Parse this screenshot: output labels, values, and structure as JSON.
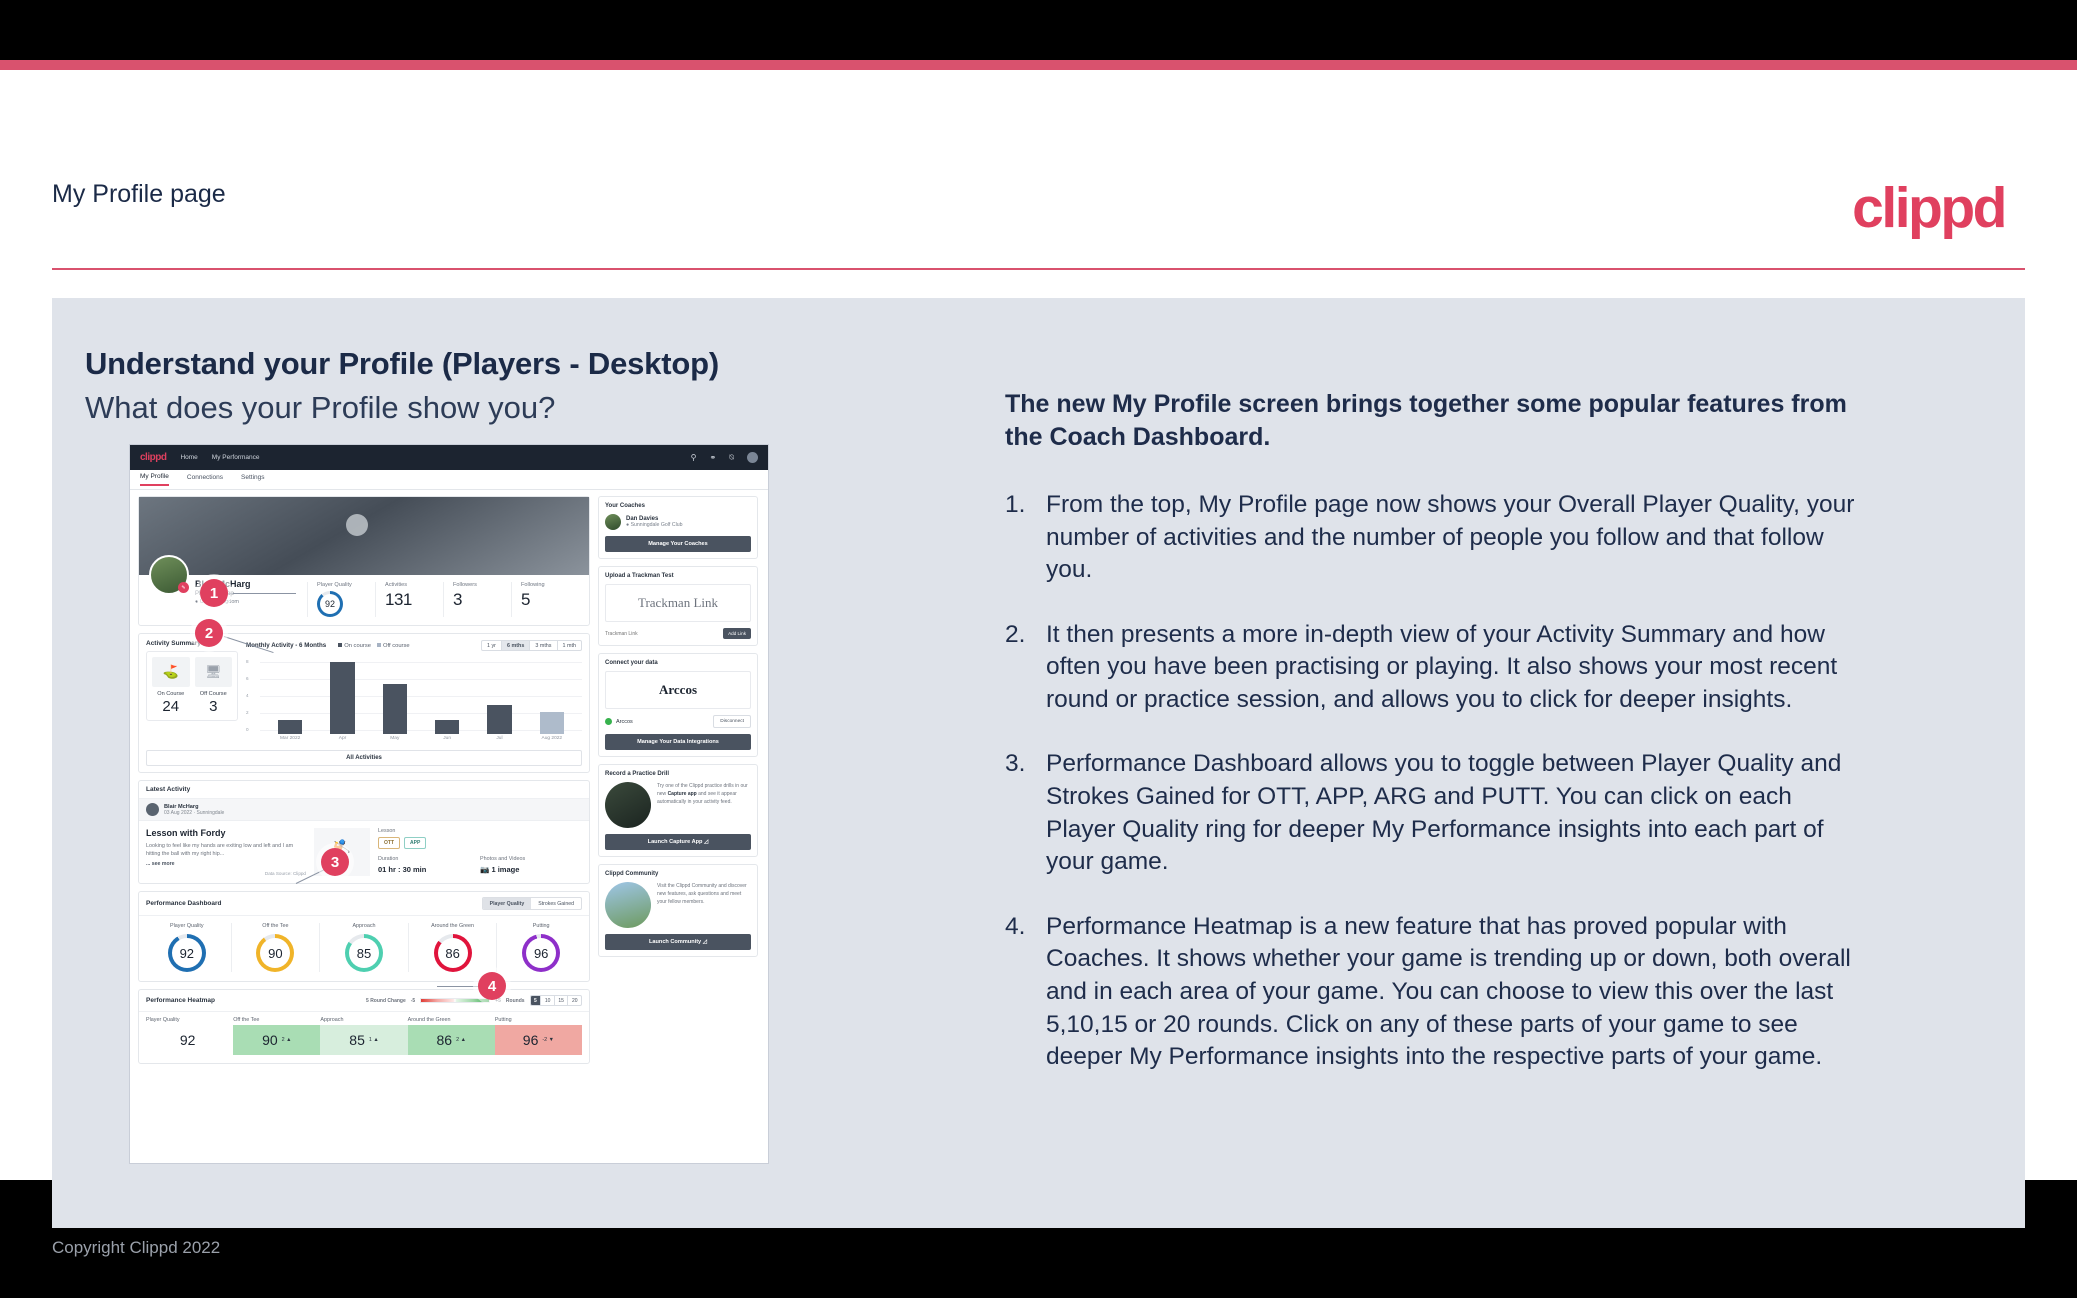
{
  "header": {
    "title": "My Profile page",
    "logo": "clippd"
  },
  "slide": {
    "heading": "Understand your Profile (Players - Desktop)",
    "subheading": "What does your Profile show you?",
    "lead": "The new My Profile screen brings together some popular features from the Coach Dashboard.",
    "points": [
      {
        "num": "1.",
        "text": "From the top, My Profile page now shows your Overall Player Quality, your number of activities and the number of people you follow and that follow you."
      },
      {
        "num": "2.",
        "text": "It then presents a more in-depth view of your Activity Summary and how often you have been practising or playing. It also shows your most recent round or practice session, and allows you to click for deeper insights."
      },
      {
        "num": "3.",
        "text": "Performance Dashboard allows you to toggle between Player Quality and Strokes Gained for OTT, APP, ARG and PUTT. You can click on each Player Quality ring for deeper My Performance insights into each part of your game."
      },
      {
        "num": "4.",
        "text": "Performance Heatmap is a new feature that has proved popular with Coaches. It shows whether your game is trending up or down, both overall and in each area of your game. You can choose to view this over the last 5,10,15 or 20 rounds. Click on any of these parts of your game to see deeper My Performance insights into the respective parts of your game."
      }
    ],
    "callouts": [
      "1",
      "2",
      "3",
      "4"
    ]
  },
  "app": {
    "nav": {
      "logo": "clippd",
      "links": [
        "Home",
        "My Performance"
      ],
      "icons": [
        "search-icon",
        "community-icon",
        "add-circle-icon",
        "avatar-icon"
      ]
    },
    "tabs": [
      {
        "label": "My Profile",
        "active": true
      },
      {
        "label": "Connections",
        "active": false
      },
      {
        "label": "Settings",
        "active": false
      }
    ],
    "profile": {
      "name": "Blair McHarg",
      "handicap": "Plus Handicap",
      "location": "United Kingdom",
      "stats": [
        {
          "label": "Player Quality",
          "value": "92",
          "type": "ring"
        },
        {
          "label": "Activities",
          "value": "131",
          "type": "number"
        },
        {
          "label": "Followers",
          "value": "3",
          "type": "number"
        },
        {
          "label": "Following",
          "value": "5",
          "type": "number"
        }
      ]
    },
    "activity_summary": {
      "title": "Activity Summary",
      "chart_title": "Monthly Activity - 6 Months",
      "legend": [
        "On course",
        "Off course"
      ],
      "ranges": [
        {
          "label": "1 yr",
          "active": false
        },
        {
          "label": "6 mths",
          "active": true
        },
        {
          "label": "3 mths",
          "active": false
        },
        {
          "label": "1 mth",
          "active": false
        }
      ],
      "counters": [
        {
          "label": "On Course",
          "value": "24",
          "icon": "golf-flag-icon"
        },
        {
          "label": "Off Course",
          "value": "3",
          "icon": "monitor-icon"
        }
      ],
      "all_activities": "All Activities"
    },
    "latest_activity": {
      "title": "Latest Activity",
      "user": "Blair McHarg",
      "meta": "03 Aug 2022 · Sunningdale",
      "post_title": "Lesson with Fordy",
      "post_desc": "Looking to feel like my hands are exiting low and left and I am hitting the ball with my right hip...",
      "see_more": "... see more",
      "data_source": "Data Source: Clippd",
      "type_label": "Lesson",
      "chips": [
        "OTT",
        "APP"
      ],
      "duration_label": "Duration",
      "duration_value": "01 hr : 30 min",
      "media_label": "Photos and Videos",
      "media_value": "1 image"
    },
    "performance_dashboard": {
      "title": "Performance Dashboard",
      "toggle": [
        {
          "label": "Player Quality",
          "active": true
        },
        {
          "label": "Strokes Gained",
          "active": false
        }
      ],
      "rings": [
        {
          "label": "Player Quality",
          "value": "92",
          "color": "#1f6fb2"
        },
        {
          "label": "Off the Tee",
          "value": "90",
          "color": "#f0b429"
        },
        {
          "label": "Approach",
          "value": "85",
          "color": "#4ecfb0"
        },
        {
          "label": "Around the Green",
          "value": "86",
          "color": "#e0143c"
        },
        {
          "label": "Putting",
          "value": "96",
          "color": "#8e2fc9"
        }
      ]
    },
    "performance_heatmap": {
      "title": "Performance Heatmap",
      "change_label": "5 Round Change",
      "scale_min": "-5",
      "scale_max": "+5",
      "rounds_label": "Rounds",
      "rounds": [
        {
          "label": "5",
          "active": true
        },
        {
          "label": "10",
          "active": false
        },
        {
          "label": "15",
          "active": false
        },
        {
          "label": "20",
          "active": false
        }
      ],
      "cells": [
        {
          "label": "Player Quality",
          "value": "92",
          "delta": "",
          "bg": "#ffffff"
        },
        {
          "label": "Off the Tee",
          "value": "90",
          "delta": "2 ▲",
          "bg": "#a9ddb4"
        },
        {
          "label": "Approach",
          "value": "85",
          "delta": "1 ▲",
          "bg": "#d7eedd"
        },
        {
          "label": "Around the Green",
          "value": "86",
          "delta": "2 ▲",
          "bg": "#a9ddb4"
        },
        {
          "label": "Putting",
          "value": "96",
          "delta": "-2 ▼",
          "bg": "#f0a8a2"
        }
      ]
    },
    "sidebar": {
      "coaches": {
        "title": "Your Coaches",
        "coach_name": "Dan Davies",
        "coach_club": "Sunningdale Golf Club",
        "button": "Manage Your Coaches"
      },
      "trackman": {
        "title": "Upload a Trackman Test",
        "logo": "Trackman Link",
        "input_placeholder": "Trackman Link",
        "button": "Add Link"
      },
      "connect": {
        "title": "Connect your data",
        "logo": "Arccos",
        "source": "Arccos",
        "disconnect": "Disconnect",
        "button": "Manage Your Data Integrations"
      },
      "drill": {
        "title": "Record a Practice Drill",
        "text_1": "Try one of the Clippd practice drills in our new ",
        "text_bold": "Capture app",
        "text_2": " and see it appear automatically in your activity feed.",
        "button": "Launch Capture App"
      },
      "community": {
        "title": "Clippd Community",
        "text": "Visit the Clippd Community and discover new features, ask questions and meet your fellow members.",
        "button": "Launch Community"
      }
    }
  },
  "footer": {
    "copyright": "Copyright Clippd 2022"
  },
  "chart_data": {
    "type": "bar",
    "title": "Monthly Activity - 6 Months",
    "categories": [
      "Mar 2022",
      "Apr",
      "May",
      "Jun",
      "Jul",
      "Aug 2022"
    ],
    "values": [
      2,
      10,
      7,
      2,
      4,
      3
    ],
    "series": [
      {
        "name": "On course",
        "values": [
          2,
          10,
          7,
          2,
          4,
          null
        ],
        "color": "#4a5360"
      },
      {
        "name": "Off course",
        "values": [
          null,
          null,
          null,
          null,
          null,
          3
        ],
        "color": "#aebbcb"
      }
    ],
    "xlabel": "",
    "ylabel": "",
    "ylim": [
      0,
      10
    ],
    "yticks": [
      0,
      2,
      4,
      6,
      8
    ],
    "grid": true,
    "legend_position": "top"
  }
}
